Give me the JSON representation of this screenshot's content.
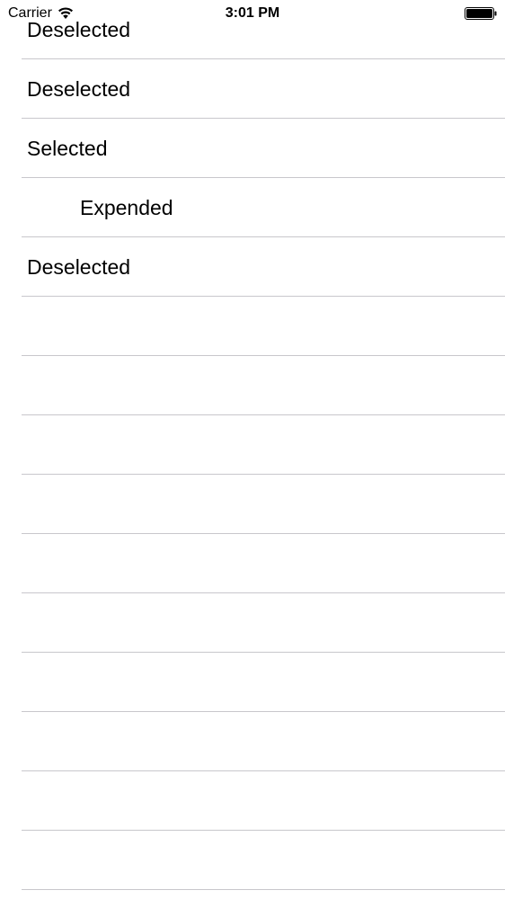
{
  "status_bar": {
    "carrier": "Carrier",
    "time": "3:01 PM",
    "wifi_icon": "wifi-icon",
    "battery_icon": "battery-icon",
    "battery_level": 1.0
  },
  "table": {
    "rows": [
      {
        "label": "Deselected",
        "state": "deselected",
        "indented": false
      },
      {
        "label": "Deselected",
        "state": "deselected",
        "indented": false
      },
      {
        "label": "Selected",
        "state": "selected",
        "indented": false
      },
      {
        "label": "Expended",
        "state": "expanded",
        "indented": true
      },
      {
        "label": "Deselected",
        "state": "deselected",
        "indented": false
      },
      {
        "label": "",
        "state": "empty",
        "indented": false
      },
      {
        "label": "",
        "state": "empty",
        "indented": false
      },
      {
        "label": "",
        "state": "empty",
        "indented": false
      },
      {
        "label": "",
        "state": "empty",
        "indented": false
      },
      {
        "label": "",
        "state": "empty",
        "indented": false
      },
      {
        "label": "",
        "state": "empty",
        "indented": false
      },
      {
        "label": "",
        "state": "empty",
        "indented": false
      },
      {
        "label": "",
        "state": "empty",
        "indented": false
      },
      {
        "label": "",
        "state": "empty",
        "indented": false
      },
      {
        "label": "",
        "state": "empty",
        "indented": false
      }
    ]
  }
}
